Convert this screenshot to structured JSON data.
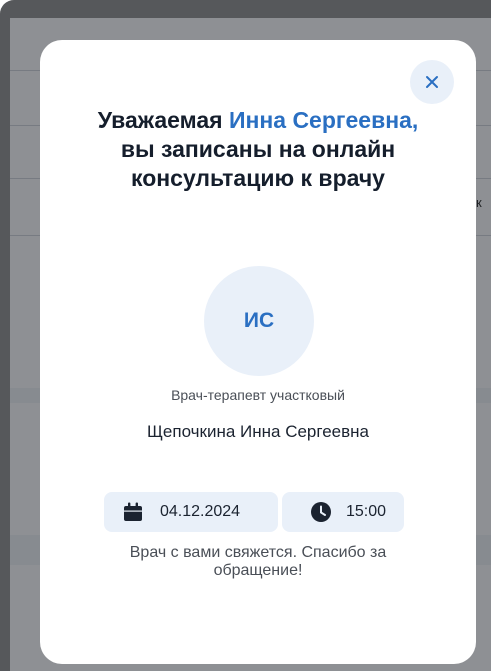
{
  "background": {
    "side_text": "тк"
  },
  "modal": {
    "title_prefix": "Уважаемая",
    "patient_name": "Инна Сергеевна,",
    "title_suffix": "вы записаны на онлайн консультацию к врачу",
    "close_icon": "close-icon",
    "avatar_initials": "ИС",
    "doctor_role": "Врач-терапевт участковый",
    "doctor_name": "Щепочкина Инна Сергеевна",
    "date": "04.12.2024",
    "date_icon": "calendar-icon",
    "time": "15:00",
    "time_icon": "clock-icon",
    "note": "Врач с вами свяжется. Спасибо за обращение!"
  },
  "colors": {
    "accent": "#2a6fc2",
    "chip_bg": "#e9f0f9",
    "title": "#151e2c"
  }
}
